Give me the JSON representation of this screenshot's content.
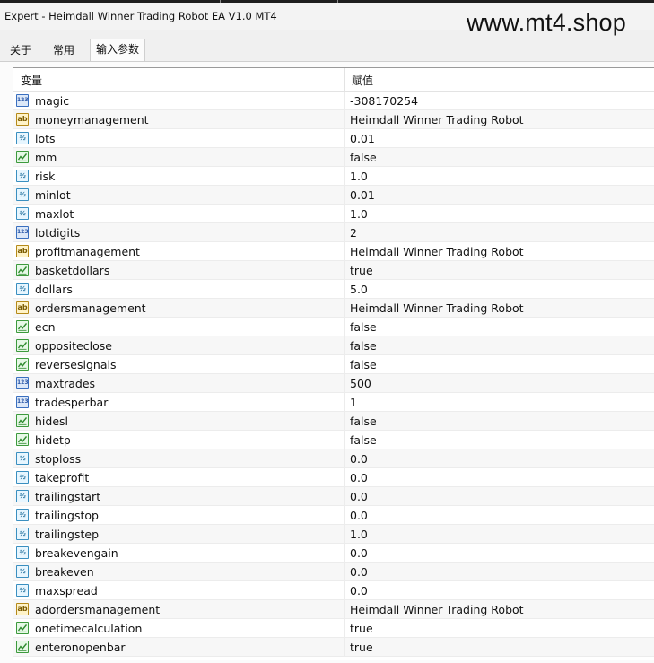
{
  "window": {
    "title": "Expert - Heimdall Winner Trading Robot EA V1.0 MT4",
    "watermark": "www.mt4.shop"
  },
  "tabs": [
    {
      "label": "关于"
    },
    {
      "label": "常用"
    },
    {
      "label": "输入参数",
      "active": true
    }
  ],
  "table": {
    "headers": {
      "variable": "变量",
      "value": "赋值"
    },
    "rows": [
      {
        "type": "int",
        "name": "magic",
        "value": "-308170254"
      },
      {
        "type": "string",
        "name": "moneymanagement",
        "value": " Heimdall Winner Trading Robot"
      },
      {
        "type": "double",
        "name": "lots",
        "value": "0.01"
      },
      {
        "type": "bool",
        "name": "mm",
        "value": "false"
      },
      {
        "type": "double",
        "name": "risk",
        "value": "1.0"
      },
      {
        "type": "double",
        "name": "minlot",
        "value": "0.01"
      },
      {
        "type": "double",
        "name": "maxlot",
        "value": "1.0"
      },
      {
        "type": "int",
        "name": "lotdigits",
        "value": "2"
      },
      {
        "type": "string",
        "name": "profitmanagement",
        "value": "Heimdall Winner Trading Robot"
      },
      {
        "type": "bool",
        "name": "basketdollars",
        "value": "true"
      },
      {
        "type": "double",
        "name": "dollars",
        "value": "5.0"
      },
      {
        "type": "string",
        "name": "ordersmanagement",
        "value": "Heimdall Winner Trading Robot"
      },
      {
        "type": "bool",
        "name": "ecn",
        "value": "false"
      },
      {
        "type": "bool",
        "name": "oppositeclose",
        "value": "false"
      },
      {
        "type": "bool",
        "name": "reversesignals",
        "value": "false"
      },
      {
        "type": "int",
        "name": "maxtrades",
        "value": "500"
      },
      {
        "type": "int",
        "name": "tradesperbar",
        "value": "1"
      },
      {
        "type": "bool",
        "name": "hidesl",
        "value": "false"
      },
      {
        "type": "bool",
        "name": "hidetp",
        "value": "false"
      },
      {
        "type": "double",
        "name": "stoploss",
        "value": "0.0"
      },
      {
        "type": "double",
        "name": "takeprofit",
        "value": "0.0"
      },
      {
        "type": "double",
        "name": "trailingstart",
        "value": "0.0"
      },
      {
        "type": "double",
        "name": "trailingstop",
        "value": "0.0"
      },
      {
        "type": "double",
        "name": "trailingstep",
        "value": "1.0"
      },
      {
        "type": "double",
        "name": "breakevengain",
        "value": "0.0"
      },
      {
        "type": "double",
        "name": "breakeven",
        "value": "0.0"
      },
      {
        "type": "double",
        "name": "maxspread",
        "value": "0.0"
      },
      {
        "type": "string",
        "name": "adordersmanagement",
        "value": "Heimdall Winner Trading Robot"
      },
      {
        "type": "bool",
        "name": "onetimecalculation",
        "value": "true"
      },
      {
        "type": "bool",
        "name": "enteronopenbar",
        "value": "true"
      }
    ]
  },
  "icons": {
    "int": {
      "name": "integer-type-icon",
      "glyph": "123"
    },
    "string": {
      "name": "string-type-icon",
      "glyph": "ab"
    },
    "double": {
      "name": "double-type-icon",
      "glyph": "½"
    },
    "bool": {
      "name": "boolean-type-icon",
      "glyph": ""
    }
  },
  "colors": {
    "background": "#f0f0f0",
    "grid_background": "#ffffff",
    "row_divider": "#ececec"
  }
}
